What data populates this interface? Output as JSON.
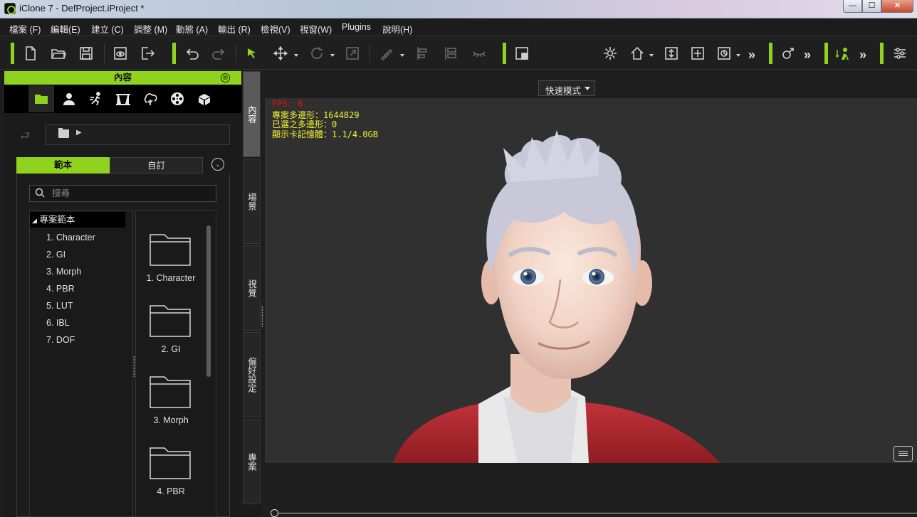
{
  "window": {
    "title": "iClone 7 - DefProject.iProject *",
    "min_glyph": "—",
    "max_glyph": "☐",
    "close_glyph": "✕"
  },
  "menu": [
    "檔案 (F)",
    "編輯(E)",
    "建立 (C)",
    "調整 (M)",
    "動態 (A)",
    "輸出 (R)",
    "檢視(V)",
    "視窗(W)",
    "Plugins",
    "說明(H)"
  ],
  "toolbar": {
    "mode_select": "快速模式",
    "more": "»",
    "icons": [
      "new-file-icon",
      "open-folder-icon",
      "save-icon",
      "preview-icon",
      "export-icon",
      "undo-icon",
      "redo-icon",
      "select-arrow-icon",
      "move-icon",
      "rotate-icon",
      "scale-icon",
      "snap-icon",
      "align-left-icon",
      "align-distribute-icon",
      "blink-icon",
      "layout-icon",
      "light-icon",
      "home-icon",
      "fit-icon",
      "frame-icon",
      "camera-icon",
      "gender-icon",
      "character-icon",
      "settings-icon"
    ]
  },
  "content_panel": {
    "title": "內容",
    "close_glyph": "⊗",
    "category_icons": [
      "folder-icon",
      "avatar-icon",
      "motion-icon",
      "stage-icon",
      "tree-icon",
      "film-reel-icon",
      "prop-box-icon"
    ],
    "tabs": {
      "template": "範本",
      "custom": "自訂",
      "expand_glyph": "⌄"
    },
    "nav_back_glyph": "⮐",
    "path_arrow": "▶",
    "search": {
      "placeholder": "搜尋"
    },
    "tree": {
      "root": "專案範本",
      "items": [
        "1. Character",
        "2. GI",
        "3. Morph",
        "4. PBR",
        "5. LUT",
        "6. IBL",
        "7. DOF"
      ]
    },
    "grid_items": [
      "1. Character",
      "2. GI",
      "3. Morph",
      "4. PBR"
    ]
  },
  "side_tabs": [
    "內容",
    "場景",
    "視覺",
    "偏好設定",
    "專案"
  ],
  "viewport": {
    "hud": {
      "fps": "FPS: 0.",
      "project_polygons": "專案多邊形：1644829",
      "selected_polygons": "已選之多邊形：0",
      "video_memory": "顯示卡記憶體：1.1/4.0GB"
    }
  },
  "colors": {
    "accent": "#8fd31f",
    "hud_fps": "#e01010",
    "hud_text": "#f2f233",
    "jacket": "#b3272b",
    "hair": "#c8c8d8",
    "skin": "#f0d2c4"
  }
}
